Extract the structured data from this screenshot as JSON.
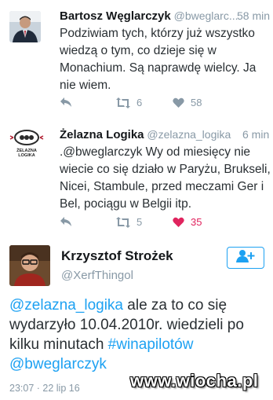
{
  "tweets": [
    {
      "name": "Bartosz Węglarczyk",
      "handle": "@bweglarc...",
      "time": "58 min",
      "lines": [
        "Podziwiam tych, którzy już wszystko",
        "wiedzą o tym, co dzieje się w",
        "Monachium. Są naprawdę wielcy. Ja",
        "nie wiem."
      ],
      "retweets": "6",
      "likes": "58"
    },
    {
      "name": "Żelazna Logika",
      "handle": "@zelazna_logika",
      "time": "6 min",
      "lines": [
        ".@bweglarczyk Wy od miesięcy nie",
        "wiecie co się działo w Paryżu, Brukseli,",
        "Nicei, Stambule, przed meczami Ger i",
        "Bel, pociągu w Belgii itp."
      ],
      "avatar_text": "ŻELAZNA LOGIKA",
      "retweets": "5",
      "likes": "35"
    }
  ],
  "main": {
    "name": "Krzysztof Strożek",
    "handle": "@XerfThingol",
    "mention1": "@zelazna_logika",
    "text1": " ale za to co się",
    "line2": "wydarzyło 10.04.2010r. wiedzieli po",
    "text3a": "kilku minutach ",
    "hashtag": "#winapilotów",
    "mention2": "@bweglarczyk",
    "timestamp": "23:07 · 22 lip 16"
  },
  "watermark": "www.wiocha.pl",
  "colors": {
    "accent": "#1da1f2",
    "muted": "#8899a6",
    "liked": "#e0245e"
  }
}
